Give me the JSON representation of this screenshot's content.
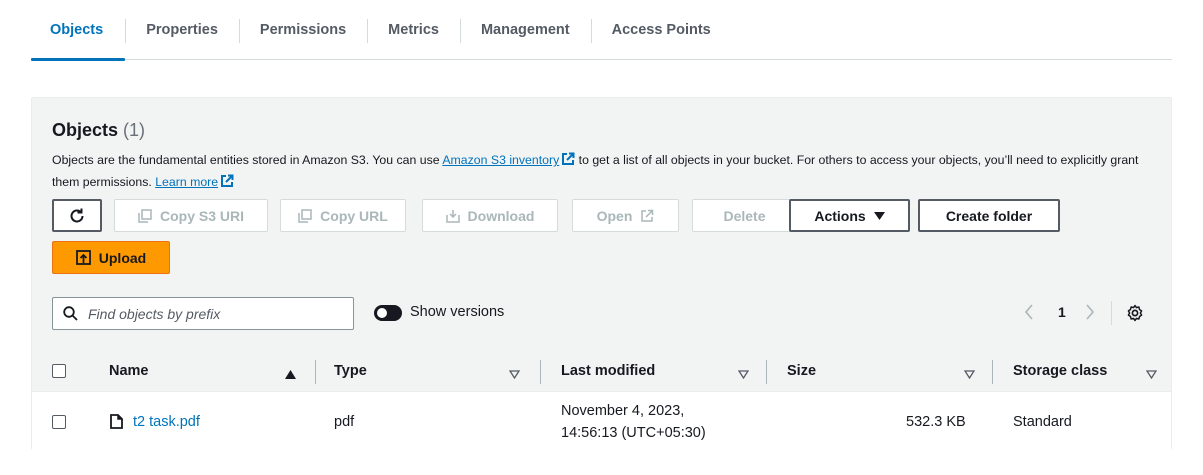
{
  "tabs": [
    {
      "label": "Objects",
      "active": true
    },
    {
      "label": "Properties",
      "active": false
    },
    {
      "label": "Permissions",
      "active": false
    },
    {
      "label": "Metrics",
      "active": false
    },
    {
      "label": "Management",
      "active": false
    },
    {
      "label": "Access Points",
      "active": false
    }
  ],
  "panel": {
    "title": "Objects",
    "count": "(1)",
    "desc_part1": "Objects are the fundamental entities stored in Amazon S3. You can use ",
    "inventory_link": "Amazon S3 inventory",
    "desc_part2": " to get a list of all objects in your bucket. For others to access your objects, you’ll need to explicitly grant them permissions. ",
    "learn_more": "Learn more"
  },
  "toolbar": {
    "refresh_icon": "refresh-icon",
    "copy_s3_uri": "Copy S3 URI",
    "copy_url": "Copy URL",
    "download": "Download",
    "open": "Open",
    "delete": "Delete",
    "actions": "Actions",
    "create_folder": "Create folder",
    "upload": "Upload"
  },
  "search": {
    "placeholder": "Find objects by prefix",
    "value": ""
  },
  "versions": {
    "label": "Show versions",
    "on": false
  },
  "pagination": {
    "page": "1"
  },
  "table": {
    "headers": {
      "name": "Name",
      "type": "Type",
      "last_modified": "Last modified",
      "size": "Size",
      "storage_class": "Storage class"
    },
    "rows": [
      {
        "name": "t2 task.pdf",
        "type": "pdf",
        "last_modified_line1": "November 4, 2023,",
        "last_modified_line2": "14:56:13 (UTC+05:30)",
        "size": "532.3 KB",
        "storage_class": "Standard"
      }
    ]
  },
  "colors": {
    "accent": "#0073bb",
    "upload_button": "#ff9900",
    "panel_bg": "#f2f3f3"
  }
}
